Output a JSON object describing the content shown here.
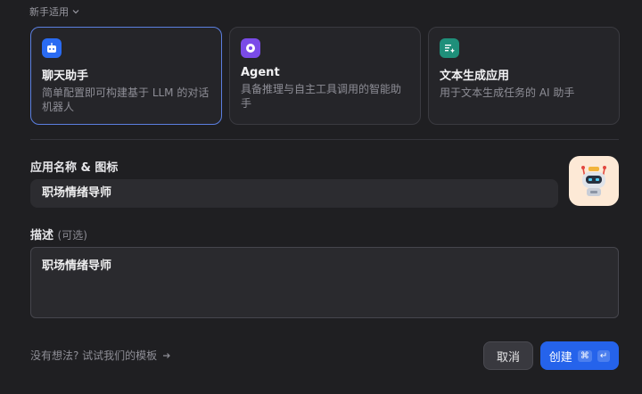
{
  "section": {
    "title": "新手适用",
    "chevron_icon": "chevron-down-icon"
  },
  "cards": [
    {
      "title": "聊天助手",
      "desc_line1": "简单配置即可构建基于 LLM 的对话",
      "desc_line2": "机器人",
      "icon": "chat-bot-icon",
      "color": "#2a6bf2",
      "selected": true
    },
    {
      "title": "Agent",
      "desc_line1": "具备推理与自主工具调用的智能助",
      "desc_line2": "手",
      "icon": "agent-brain-icon",
      "color": "#7a4be8",
      "selected": false
    },
    {
      "title": "文本生成应用",
      "desc_line1": "用于文本生成任务的 AI 助手",
      "desc_line2": "",
      "icon": "text-sparkle-icon",
      "color": "#1f8f7a",
      "selected": false
    }
  ],
  "form": {
    "name_label": "应用名称 & 图标",
    "name_value": "职场情绪导师",
    "avatar_icon": "robot-icon",
    "desc_label": "描述",
    "desc_optional": "(可选)",
    "desc_value": "职场情绪导师"
  },
  "footer": {
    "hint": "没有想法? 试试我们的模板",
    "hint_icon": "arrow-right-icon",
    "cancel_label": "取消",
    "create_label": "创建",
    "shortcut_cmd": "⌘",
    "shortcut_enter": "↵"
  }
}
